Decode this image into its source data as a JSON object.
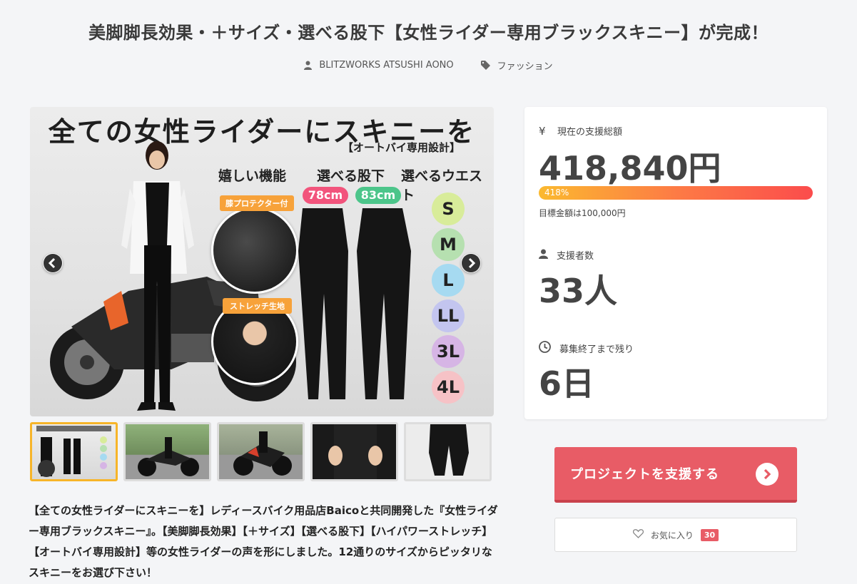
{
  "project": {
    "title": "美脚脚長効果・＋サイズ・選べる股下【女性ライダー専用ブラックスキニー】が完成！",
    "author": "BLITZWORKS ATSUSHI AONO",
    "category": "ファッション"
  },
  "hero": {
    "headline": "全ての女性ライダーにスキニーを",
    "subhead": "【オートバイ専用設計】",
    "label_features": "嬉しい機能",
    "label_inseam": "選べる股下",
    "label_waist": "選べるウエスト",
    "inseam_1": "78cm",
    "inseam_2": "83cm",
    "tag_knee": "膝プロテクター付",
    "tag_stretch": "ストレッチ生地",
    "sizes": [
      "S",
      "M",
      "L",
      "LL",
      "3L",
      "4L"
    ],
    "colors": {
      "inseam_1": "#f2547c",
      "inseam_2": "#4cc58a",
      "size_s": "#d8ec9a",
      "size_m": "#b6e0b0",
      "size_l": "#a6daf1",
      "size_ll": "#c3c5ef",
      "size_3l": "#d6b5e5",
      "size_4l": "#f6c2c6"
    }
  },
  "description": "【全ての女性ライダーにスキニーを】レディースバイク用品店Baicoと共同開発した『女性ライダー専用ブラックスキニー』。【美脚脚長効果】【＋サイズ】【選べる股下】【ハイパワーストレッチ】【オートバイ専用設計】等の女性ライダーの声を形にしました。12通りのサイズからピッタリなスキニーをお選び下さい！",
  "stats": {
    "total_label": "現在の支援総額",
    "total_value": "418,840円",
    "progress_text": "418%",
    "progress_percent": 418,
    "target_text": "目標金額は100,000円",
    "backers_label": "支援者数",
    "backers_value": "33人",
    "remaining_label": "募集終了まで残り",
    "remaining_value": "6日",
    "yen_symbol": "¥"
  },
  "actions": {
    "support_label": "プロジェクトを支援する",
    "favorite_label": "お気に入り",
    "favorite_count": "30"
  },
  "colors": {
    "accent": "#e85c66",
    "progress_start": "#fbb92f",
    "progress_end": "#fb4c4c",
    "thumb_active": "#f7b529"
  },
  "icons": {
    "author": "user-icon",
    "category": "tag-icon",
    "prev": "chevron-left-icon",
    "next": "chevron-right-icon",
    "total": "yen-icon",
    "backers": "user-icon",
    "remaining": "clock-icon",
    "support": "chevron-right-icon",
    "favorite": "heart-icon"
  }
}
